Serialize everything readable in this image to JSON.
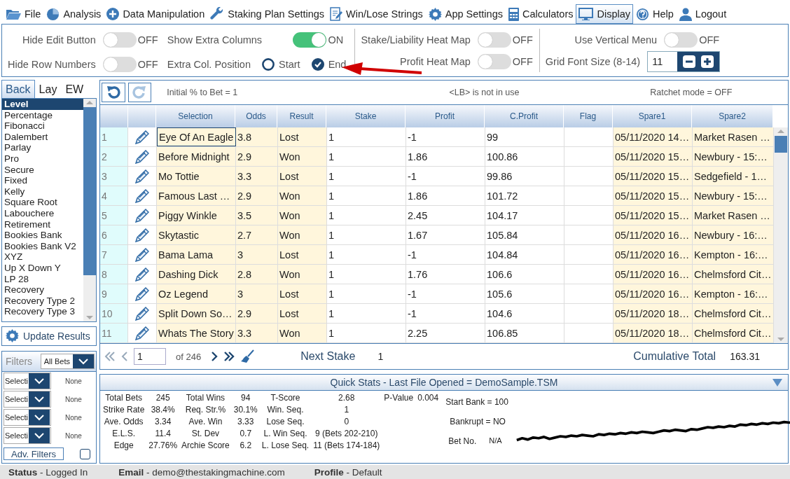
{
  "menu": [
    {
      "label": "File",
      "selected": false
    },
    {
      "label": "Analysis",
      "selected": false
    },
    {
      "label": "Data Manipulation",
      "selected": false
    },
    {
      "label": "Staking Plan Settings",
      "selected": false
    },
    {
      "label": "Win/Lose Strings",
      "selected": false
    },
    {
      "label": "App Settings",
      "selected": false
    },
    {
      "label": "Calculators",
      "selected": false
    },
    {
      "label": "Display",
      "selected": true
    },
    {
      "label": "Help",
      "selected": false
    },
    {
      "label": "Logout",
      "selected": false
    }
  ],
  "settings_sections": [
    {
      "columns": [
        [
          {
            "kind": "toggle",
            "label": "Hide Edit Button",
            "on": false,
            "state": "OFF"
          },
          {
            "kind": "toggle",
            "label": "Hide Row Numbers",
            "on": false,
            "state": "OFF"
          }
        ],
        [
          {
            "kind": "toggle",
            "label": "Show Extra Columns",
            "on": true,
            "state": "ON"
          },
          {
            "kind": "radio",
            "label": "Extra Col. Position",
            "options": [
              {
                "label": "Start",
                "selected": false
              },
              {
                "label": "End",
                "selected": true
              }
            ]
          }
        ]
      ]
    },
    {
      "columns": [
        [
          {
            "kind": "toggle",
            "label": "Stake/Liability Heat Map",
            "on": false,
            "state": "OFF"
          },
          {
            "kind": "toggle",
            "label": "Profit Heat Map",
            "on": false,
            "state": "OFF"
          }
        ]
      ]
    },
    {
      "columns": [
        [
          {
            "kind": "toggle",
            "label": "Use Vertical Menu",
            "on": false,
            "state": "OFF"
          },
          {
            "kind": "stepper",
            "label": "Grid Font Size (8-14)",
            "value": "11"
          }
        ]
      ]
    }
  ],
  "bet_tabs": [
    {
      "label": "Back",
      "selected": true
    },
    {
      "label": "Lay",
      "selected": false
    },
    {
      "label": "EW",
      "selected": false
    }
  ],
  "staking_plans": [
    {
      "label": "Level",
      "selected": true
    },
    {
      "label": "Percentage",
      "selected": false
    },
    {
      "label": "Fibonacci",
      "selected": false
    },
    {
      "label": "Dalembert",
      "selected": false
    },
    {
      "label": "Parlay",
      "selected": false
    },
    {
      "label": "Pro",
      "selected": false
    },
    {
      "label": "Secure",
      "selected": false
    },
    {
      "label": "Fixed",
      "selected": false
    },
    {
      "label": "Kelly",
      "selected": false
    },
    {
      "label": "Square Root",
      "selected": false
    },
    {
      "label": "Labouchere",
      "selected": false
    },
    {
      "label": "Retirement",
      "selected": false
    },
    {
      "label": "Bookies Bank",
      "selected": false
    },
    {
      "label": "Bookies Bank V2",
      "selected": false
    },
    {
      "label": "XYZ",
      "selected": false
    },
    {
      "label": "Up X Down Y",
      "selected": false
    },
    {
      "label": "LP 28",
      "selected": false
    },
    {
      "label": "Recovery",
      "selected": false
    },
    {
      "label": "Recovery Type 2",
      "selected": false
    },
    {
      "label": "Recovery Type 3",
      "selected": false
    }
  ],
  "update_button": "Update Results",
  "filters": {
    "title": "Filters",
    "mode": "All Bets",
    "rows": [
      {
        "field": "Selecti",
        "value": "None"
      },
      {
        "field": "Selecti",
        "value": "None"
      },
      {
        "field": "Selecti",
        "value": "None"
      },
      {
        "field": "Selecti",
        "value": "None"
      }
    ],
    "adv_button": "Adv. Filters",
    "adv_checked": false
  },
  "grid": {
    "info": [
      "Initial % to Bet = 1",
      "<LB> is not in use",
      "Ratchet mode = OFF"
    ],
    "columns": [
      {
        "label": "Selection",
        "highlighted": true
      },
      {
        "label": "Odds",
        "highlighted": true
      },
      {
        "label": "Result",
        "highlighted": true
      },
      {
        "label": "Stake",
        "highlighted": false
      },
      {
        "label": "Profit",
        "highlighted": false
      },
      {
        "label": "C.Profit",
        "highlighted": false
      },
      {
        "label": "Flag",
        "highlighted": false
      },
      {
        "label": "Spare1",
        "highlighted": true
      },
      {
        "label": "Spare2",
        "highlighted": true
      }
    ],
    "rows": [
      {
        "number": "1",
        "selected": true,
        "cells": [
          "Eye Of An Eagle",
          "3.8",
          "Lost",
          "1",
          "-1",
          "99",
          null,
          "05/11/2020 14…",
          "Market Rasen …"
        ]
      },
      {
        "number": "2",
        "selected": false,
        "cells": [
          "Before Midnight",
          "2.9",
          "Won",
          "1",
          "1.86",
          "100.86",
          null,
          "05/11/2020 15…",
          "Newbury - 15:…"
        ]
      },
      {
        "number": "3",
        "selected": false,
        "cells": [
          "Mo Tottie",
          "3.3",
          "Lost",
          "1",
          "-1",
          "99.86",
          null,
          "05/11/2020 15…",
          "Sedgefield - 1…"
        ]
      },
      {
        "number": "4",
        "selected": false,
        "cells": [
          "Famous Last …",
          "2.9",
          "Won",
          "1",
          "1.86",
          "101.72",
          null,
          "05/11/2020 15…",
          "Newbury - 15:…"
        ]
      },
      {
        "number": "5",
        "selected": false,
        "cells": [
          "Piggy Winkle",
          "3.5",
          "Won",
          "1",
          "2.45",
          "104.17",
          null,
          "05/11/2020 15…",
          "Market Rasen …"
        ]
      },
      {
        "number": "6",
        "selected": false,
        "cells": [
          "Skytastic",
          "2.7",
          "Won",
          "1",
          "1.67",
          "105.84",
          null,
          "05/11/2020 16…",
          "Newbury - 16:…"
        ]
      },
      {
        "number": "7",
        "selected": false,
        "cells": [
          "Bama Lama",
          "3",
          "Lost",
          "1",
          "-1",
          "104.84",
          null,
          "05/11/2020 16…",
          "Kempton - 16:…"
        ]
      },
      {
        "number": "8",
        "selected": false,
        "cells": [
          "Dashing Dick",
          "2.8",
          "Won",
          "1",
          "1.76",
          "106.6",
          null,
          "05/11/2020 16…",
          "Chelmsford Cit…"
        ]
      },
      {
        "number": "9",
        "selected": false,
        "cells": [
          "Oz Legend",
          "3",
          "Lost",
          "1",
          "-1",
          "105.6",
          null,
          "05/11/2020 16…",
          "Kempton - 16:…"
        ]
      },
      {
        "number": "10",
        "selected": false,
        "cells": [
          "Split Down So…",
          "2.9",
          "Lost",
          "1",
          "-1",
          "104.6",
          null,
          "05/11/2020 18…",
          "Chelmsford Cit…"
        ]
      },
      {
        "number": "11",
        "selected": false,
        "cells": [
          "Whats The Story",
          "3.3",
          "Won",
          "1",
          "2.25",
          "106.85",
          null,
          "05/11/2020 18…",
          "Chelmsford Cit…"
        ]
      }
    ],
    "page": "1",
    "page_total": "of 246",
    "next_stake_label": "Next Stake",
    "next_stake": "1",
    "cumulative_label": "Cumulative Total",
    "cumulative": "163.31"
  },
  "quick_stats": {
    "title": "Quick Stats - Last File Opened = DemoSample.TSM",
    "rows": [
      [
        {
          "label": "Total Bets",
          "value": "245"
        },
        {
          "label": "Total Wins",
          "value": "94"
        },
        {
          "label": "T-Score",
          "value": "2.68"
        },
        {
          "label": "P-Value",
          "value": "0.004"
        }
      ],
      [
        {
          "label": "Strike Rate",
          "value": "38.4%"
        },
        {
          "label": "Req. Str.%",
          "value": "30.1%"
        },
        {
          "label": "Win. Seq.",
          "value": "1"
        }
      ],
      [
        {
          "label": "Ave. Odds",
          "value": "3.34"
        },
        {
          "label": "Ave. Win",
          "value": "3.33"
        },
        {
          "label": "Lose Seq.",
          "value": "0"
        }
      ],
      [
        {
          "label": "E.L.S.",
          "value": "11.4"
        },
        {
          "label": "St. Dev",
          "value": "0.7"
        },
        {
          "label": "L. Win Seq.",
          "value": "9 (Bets 202-210)"
        }
      ],
      [
        {
          "label": "Edge",
          "value": "27.76%"
        },
        {
          "label": "Archie Score",
          "value": "6.2"
        },
        {
          "label": "L. Lose Seq.",
          "value": "11 (Bets 174-184)"
        }
      ]
    ],
    "start_bank": "Start Bank = 100",
    "bankrupt": "Bankrupt = NO",
    "bet_no_label": "Bet No.",
    "bet_no": "N/A"
  },
  "status_bar": [
    "**Status** - Logged In",
    "**Email** - demo@thestakingmachine.com",
    "**Profile** - Default"
  ]
}
